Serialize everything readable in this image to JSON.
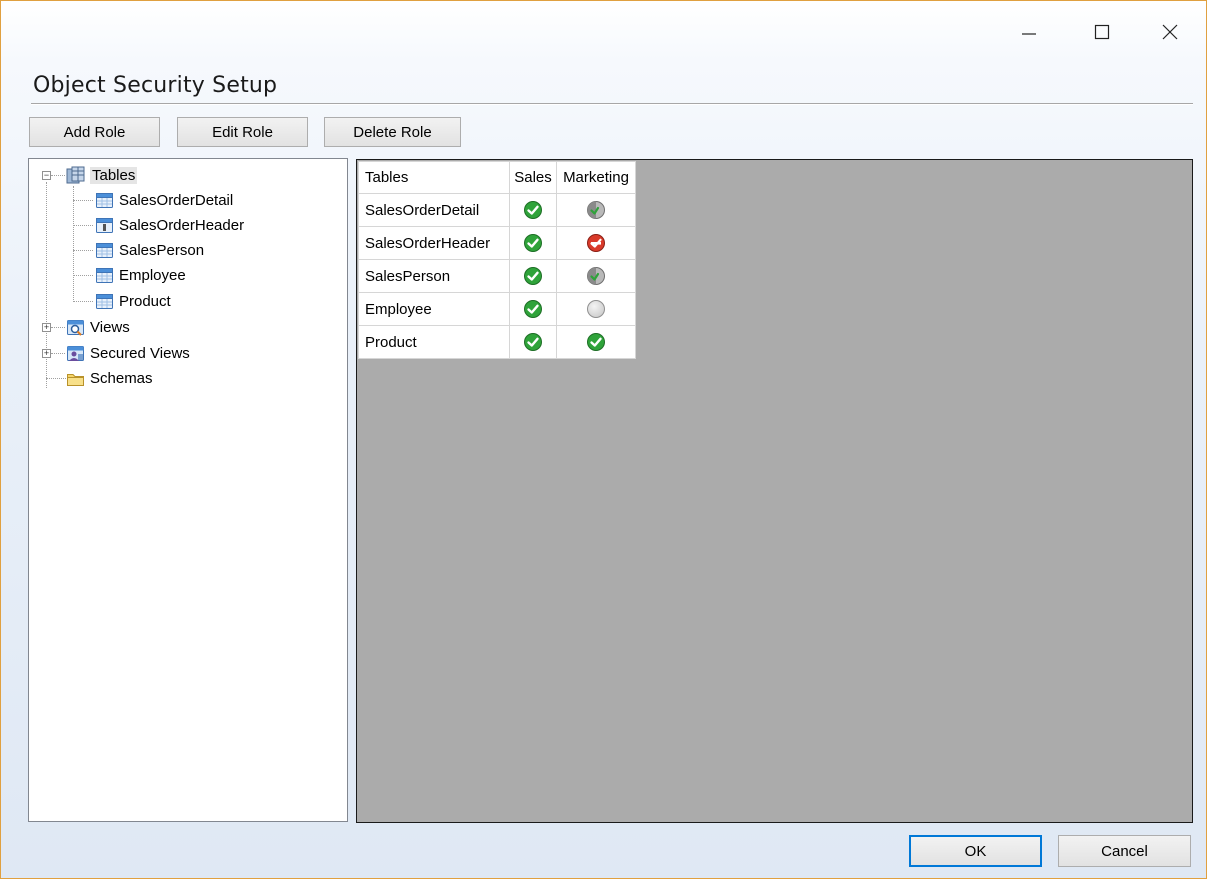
{
  "dialog": {
    "title": "Object Security Setup",
    "accent_color": "#0078d7",
    "window_border_color": "#e0a040"
  },
  "toolbar": {
    "add_role": "Add Role",
    "edit_role": "Edit Role",
    "delete_role": "Delete Role"
  },
  "tree": {
    "root_tables": {
      "label": "Tables",
      "icon": "database-tables-icon",
      "expanded": true
    },
    "tables": [
      {
        "label": "SalesOrderDetail",
        "icon": "table-icon"
      },
      {
        "label": "SalesOrderHeader",
        "icon": "table-key-icon"
      },
      {
        "label": "SalesPerson",
        "icon": "table-icon"
      },
      {
        "label": "Employee",
        "icon": "table-icon"
      },
      {
        "label": "Product",
        "icon": "table-icon"
      }
    ],
    "views": {
      "label": "Views",
      "icon": "views-icon",
      "expanded": false
    },
    "secured_views": {
      "label": "Secured Views",
      "icon": "secured-views-icon",
      "expanded": false
    },
    "schemas": {
      "label": "Schemas",
      "icon": "folder-icon"
    }
  },
  "grid": {
    "headers": {
      "name": "Tables",
      "sales": "Sales",
      "marketing": "Marketing"
    },
    "rows": [
      {
        "name": "SalesOrderDetail",
        "sales": "granted",
        "marketing": "partial"
      },
      {
        "name": "SalesOrderHeader",
        "sales": "granted",
        "marketing": "denied"
      },
      {
        "name": "SalesPerson",
        "sales": "granted",
        "marketing": "partial"
      },
      {
        "name": "Employee",
        "sales": "granted",
        "marketing": "none"
      },
      {
        "name": "Product",
        "sales": "granted",
        "marketing": "granted"
      }
    ],
    "status_colors": {
      "granted": "#2fa33a",
      "partial": "#8a8a8a",
      "denied": "#d93a2a",
      "none": "#cfcfcf"
    },
    "background": "#ababab"
  },
  "footer": {
    "ok": "OK",
    "cancel": "Cancel"
  }
}
